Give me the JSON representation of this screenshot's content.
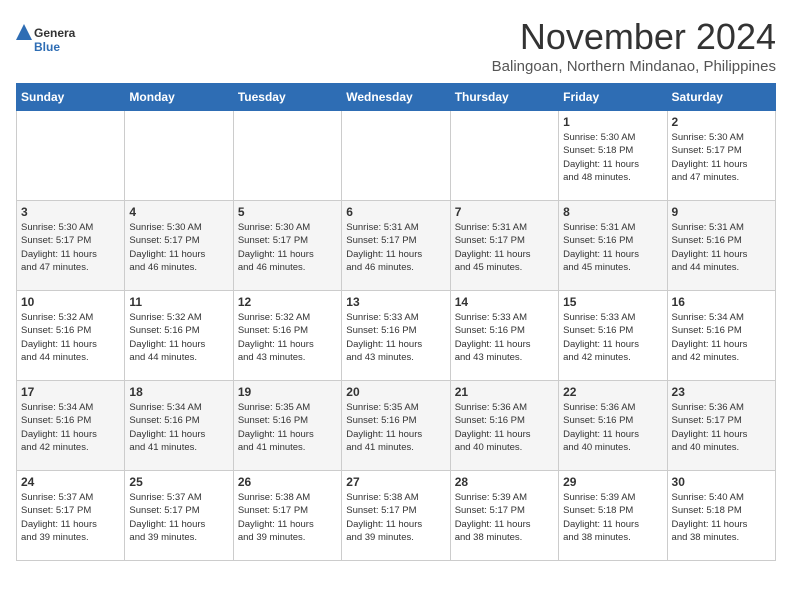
{
  "header": {
    "logo_general": "General",
    "logo_blue": "Blue",
    "month": "November 2024",
    "location": "Balingoan, Northern Mindanao, Philippines"
  },
  "weekdays": [
    "Sunday",
    "Monday",
    "Tuesday",
    "Wednesday",
    "Thursday",
    "Friday",
    "Saturday"
  ],
  "weeks": [
    [
      {
        "day": "",
        "info": ""
      },
      {
        "day": "",
        "info": ""
      },
      {
        "day": "",
        "info": ""
      },
      {
        "day": "",
        "info": ""
      },
      {
        "day": "",
        "info": ""
      },
      {
        "day": "1",
        "info": "Sunrise: 5:30 AM\nSunset: 5:18 PM\nDaylight: 11 hours\nand 48 minutes."
      },
      {
        "day": "2",
        "info": "Sunrise: 5:30 AM\nSunset: 5:17 PM\nDaylight: 11 hours\nand 47 minutes."
      }
    ],
    [
      {
        "day": "3",
        "info": "Sunrise: 5:30 AM\nSunset: 5:17 PM\nDaylight: 11 hours\nand 47 minutes."
      },
      {
        "day": "4",
        "info": "Sunrise: 5:30 AM\nSunset: 5:17 PM\nDaylight: 11 hours\nand 46 minutes."
      },
      {
        "day": "5",
        "info": "Sunrise: 5:30 AM\nSunset: 5:17 PM\nDaylight: 11 hours\nand 46 minutes."
      },
      {
        "day": "6",
        "info": "Sunrise: 5:31 AM\nSunset: 5:17 PM\nDaylight: 11 hours\nand 46 minutes."
      },
      {
        "day": "7",
        "info": "Sunrise: 5:31 AM\nSunset: 5:17 PM\nDaylight: 11 hours\nand 45 minutes."
      },
      {
        "day": "8",
        "info": "Sunrise: 5:31 AM\nSunset: 5:16 PM\nDaylight: 11 hours\nand 45 minutes."
      },
      {
        "day": "9",
        "info": "Sunrise: 5:31 AM\nSunset: 5:16 PM\nDaylight: 11 hours\nand 44 minutes."
      }
    ],
    [
      {
        "day": "10",
        "info": "Sunrise: 5:32 AM\nSunset: 5:16 PM\nDaylight: 11 hours\nand 44 minutes."
      },
      {
        "day": "11",
        "info": "Sunrise: 5:32 AM\nSunset: 5:16 PM\nDaylight: 11 hours\nand 44 minutes."
      },
      {
        "day": "12",
        "info": "Sunrise: 5:32 AM\nSunset: 5:16 PM\nDaylight: 11 hours\nand 43 minutes."
      },
      {
        "day": "13",
        "info": "Sunrise: 5:33 AM\nSunset: 5:16 PM\nDaylight: 11 hours\nand 43 minutes."
      },
      {
        "day": "14",
        "info": "Sunrise: 5:33 AM\nSunset: 5:16 PM\nDaylight: 11 hours\nand 43 minutes."
      },
      {
        "day": "15",
        "info": "Sunrise: 5:33 AM\nSunset: 5:16 PM\nDaylight: 11 hours\nand 42 minutes."
      },
      {
        "day": "16",
        "info": "Sunrise: 5:34 AM\nSunset: 5:16 PM\nDaylight: 11 hours\nand 42 minutes."
      }
    ],
    [
      {
        "day": "17",
        "info": "Sunrise: 5:34 AM\nSunset: 5:16 PM\nDaylight: 11 hours\nand 42 minutes."
      },
      {
        "day": "18",
        "info": "Sunrise: 5:34 AM\nSunset: 5:16 PM\nDaylight: 11 hours\nand 41 minutes."
      },
      {
        "day": "19",
        "info": "Sunrise: 5:35 AM\nSunset: 5:16 PM\nDaylight: 11 hours\nand 41 minutes."
      },
      {
        "day": "20",
        "info": "Sunrise: 5:35 AM\nSunset: 5:16 PM\nDaylight: 11 hours\nand 41 minutes."
      },
      {
        "day": "21",
        "info": "Sunrise: 5:36 AM\nSunset: 5:16 PM\nDaylight: 11 hours\nand 40 minutes."
      },
      {
        "day": "22",
        "info": "Sunrise: 5:36 AM\nSunset: 5:16 PM\nDaylight: 11 hours\nand 40 minutes."
      },
      {
        "day": "23",
        "info": "Sunrise: 5:36 AM\nSunset: 5:17 PM\nDaylight: 11 hours\nand 40 minutes."
      }
    ],
    [
      {
        "day": "24",
        "info": "Sunrise: 5:37 AM\nSunset: 5:17 PM\nDaylight: 11 hours\nand 39 minutes."
      },
      {
        "day": "25",
        "info": "Sunrise: 5:37 AM\nSunset: 5:17 PM\nDaylight: 11 hours\nand 39 minutes."
      },
      {
        "day": "26",
        "info": "Sunrise: 5:38 AM\nSunset: 5:17 PM\nDaylight: 11 hours\nand 39 minutes."
      },
      {
        "day": "27",
        "info": "Sunrise: 5:38 AM\nSunset: 5:17 PM\nDaylight: 11 hours\nand 39 minutes."
      },
      {
        "day": "28",
        "info": "Sunrise: 5:39 AM\nSunset: 5:17 PM\nDaylight: 11 hours\nand 38 minutes."
      },
      {
        "day": "29",
        "info": "Sunrise: 5:39 AM\nSunset: 5:18 PM\nDaylight: 11 hours\nand 38 minutes."
      },
      {
        "day": "30",
        "info": "Sunrise: 5:40 AM\nSunset: 5:18 PM\nDaylight: 11 hours\nand 38 minutes."
      }
    ]
  ]
}
